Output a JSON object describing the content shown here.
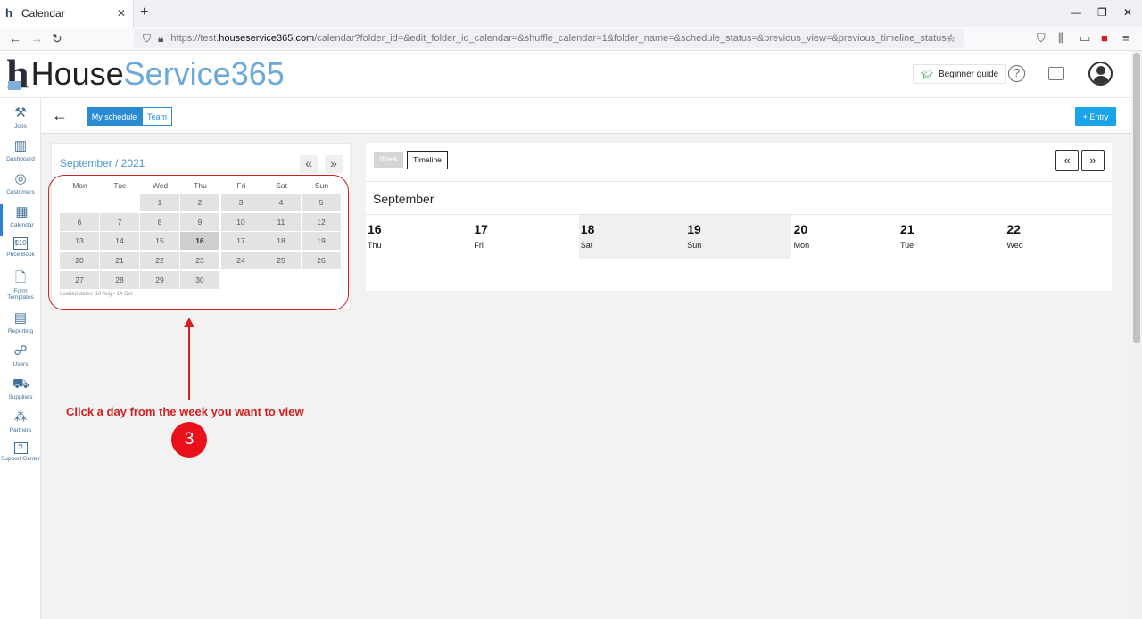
{
  "browser": {
    "tab_title": "Calendar",
    "url_prefix": "https://test.",
    "url_domain": "houseservice365.com",
    "url_rest": "/calendar?folder_id=&edit_folder_id_calendar=&shuffle_calendar=1&folder_name=&schedule_status=&previous_view=&previous_timeline_status="
  },
  "header": {
    "logo_part1": "House",
    "logo_part2": "Service365",
    "beginner_guide": "Beginner guide",
    "help_glyph": "?"
  },
  "sidebar": {
    "items": [
      {
        "label": "Jobs",
        "icon": "tools-icon"
      },
      {
        "label": "Dashboard",
        "icon": "bar-chart-icon"
      },
      {
        "label": "Customers",
        "icon": "customers-icon"
      },
      {
        "label": "Calendar",
        "icon": "calendar-icon"
      },
      {
        "label": "Price Book",
        "icon": "price-book-icon",
        "glyph": "$10"
      },
      {
        "label": "Form Templates",
        "icon": "form-templates-icon"
      },
      {
        "label": "Reporting",
        "icon": "reporting-icon"
      },
      {
        "label": "Users",
        "icon": "users-icon"
      },
      {
        "label": "Suppliers",
        "icon": "suppliers-icon"
      },
      {
        "label": "Partners",
        "icon": "partners-icon"
      },
      {
        "label": "Support Center",
        "icon": "support-icon",
        "glyph": "?"
      }
    ]
  },
  "toolbar": {
    "my_schedule": "My schedule",
    "team": "Team",
    "entry": "+ Entry"
  },
  "mini_calendar": {
    "title": "September / 2021",
    "prev": "«",
    "next": "»",
    "weekdays": [
      "Mon",
      "Tue",
      "Wed",
      "Thu",
      "Fri",
      "Sat",
      "Sun"
    ],
    "weeks": [
      [
        "",
        "",
        "1",
        "2",
        "3",
        "4",
        "5"
      ],
      [
        "6",
        "7",
        "8",
        "9",
        "10",
        "11",
        "12"
      ],
      [
        "13",
        "14",
        "15",
        "16",
        "17",
        "18",
        "19"
      ],
      [
        "20",
        "21",
        "22",
        "23",
        "24",
        "25",
        "26"
      ],
      [
        "27",
        "28",
        "29",
        "30",
        "",
        "",
        ""
      ]
    ],
    "today": "16",
    "loaded_dates": "Loaded dates: 18 Aug - 14 Oct"
  },
  "annotation": {
    "text": "Click a day from the week you want to view",
    "step": "3",
    "color": "#d21f1f"
  },
  "week_view": {
    "view_week": "Week",
    "view_timeline": "Timeline",
    "month": "September",
    "days": [
      {
        "num": "16",
        "name": "Thu",
        "weekend": false
      },
      {
        "num": "17",
        "name": "Fri",
        "weekend": false
      },
      {
        "num": "18",
        "name": "Sat",
        "weekend": true
      },
      {
        "num": "19",
        "name": "Sun",
        "weekend": true
      },
      {
        "num": "20",
        "name": "Mon",
        "weekend": false
      },
      {
        "num": "21",
        "name": "Tue",
        "weekend": false
      },
      {
        "num": "22",
        "name": "Wed",
        "weekend": false
      }
    ]
  }
}
